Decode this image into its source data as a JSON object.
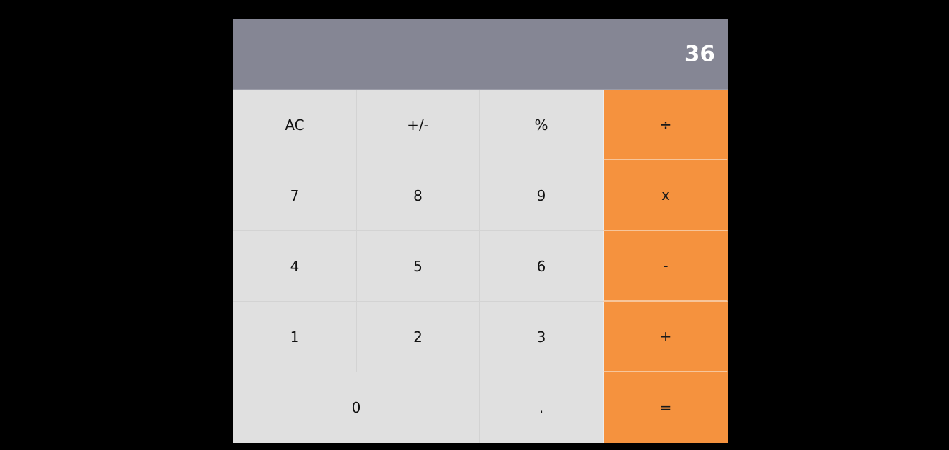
{
  "display": {
    "value": "36"
  },
  "keys": {
    "clear": "AC",
    "sign": "+/-",
    "percent": "%",
    "divide": "÷",
    "seven": "7",
    "eight": "8",
    "nine": "9",
    "multiply": "x",
    "four": "4",
    "five": "5",
    "six": "6",
    "subtract": "-",
    "one": "1",
    "two": "2",
    "three": "3",
    "add": "+",
    "zero": "0",
    "decimal": ".",
    "equals": "="
  },
  "colors": {
    "background": "#000000",
    "display": "#858694",
    "key": "#e0e0e0",
    "operator": "#f5923e"
  }
}
